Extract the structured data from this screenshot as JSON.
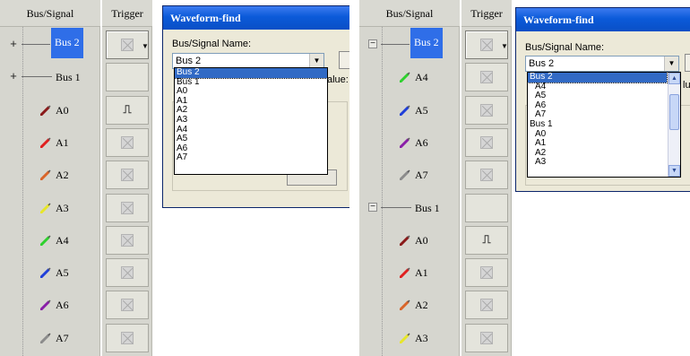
{
  "colors": {
    "selection": "#2f6ee8",
    "titlebar": "#0b5ad9",
    "dialog_bg": "#ece9d8",
    "list_highlight": "#316ac5"
  },
  "left_panel": {
    "headers": {
      "signal": "Bus/Signal",
      "trigger": "Trigger"
    },
    "rows": [
      {
        "expander": "+",
        "name": "Bus 2",
        "kind": "bus",
        "selected": true
      },
      {
        "expander": "+",
        "name": "Bus 1",
        "kind": "bus",
        "selected": false
      },
      {
        "name": "A0",
        "color": "#8a1a1a",
        "trigger": "rising-edge-icon"
      },
      {
        "name": "A1",
        "color": "#e02020"
      },
      {
        "name": "A2",
        "color": "#d9652a"
      },
      {
        "name": "A3",
        "color": "#e7e62a"
      },
      {
        "name": "A4",
        "color": "#2ed12e"
      },
      {
        "name": "A5",
        "color": "#1f3fd9"
      },
      {
        "name": "A6",
        "color": "#8a1fa8"
      },
      {
        "name": "A7",
        "color": "#8c8c8c"
      }
    ],
    "dialog": {
      "title": "Waveform-find",
      "name_label": "Bus/Signal Name:",
      "combo_value": "Bus 2",
      "value_peek": "alue:",
      "options": [
        "Bus 2",
        "Bus 1",
        "A0",
        "A1",
        "A2",
        "A3",
        "A4",
        "A5",
        "A6",
        "A7"
      ],
      "selected_option": "Bus 2"
    }
  },
  "right_panel": {
    "headers": {
      "signal": "Bus/Signal",
      "trigger": "Trigger"
    },
    "rows": [
      {
        "expander": "−",
        "name": "Bus 2",
        "kind": "bus",
        "selected": true
      },
      {
        "name": "A4",
        "color": "#2ed12e"
      },
      {
        "name": "A5",
        "color": "#1f3fd9"
      },
      {
        "name": "A6",
        "color": "#8a1fa8"
      },
      {
        "name": "A7",
        "color": "#8c8c8c"
      },
      {
        "expander": "−",
        "name": "Bus 1",
        "kind": "bus",
        "selected": false
      },
      {
        "name": "A0",
        "color": "#8a1a1a",
        "trigger": "rising-edge-icon"
      },
      {
        "name": "A1",
        "color": "#e02020"
      },
      {
        "name": "A2",
        "color": "#d9652a"
      },
      {
        "name": "A3",
        "color": "#e7e62a"
      }
    ],
    "dialog": {
      "title": "Waveform-find",
      "name_label": "Bus/Signal Name:",
      "combo_value": "Bus 2",
      "value_peek": "lu",
      "options": [
        {
          "text": "Bus 2",
          "indent": false
        },
        {
          "text": "A4",
          "indent": true
        },
        {
          "text": "A5",
          "indent": true
        },
        {
          "text": "A6",
          "indent": true
        },
        {
          "text": "A7",
          "indent": true
        },
        {
          "text": "Bus 1",
          "indent": false
        },
        {
          "text": "A0",
          "indent": true
        },
        {
          "text": "A1",
          "indent": true
        },
        {
          "text": "A2",
          "indent": true
        },
        {
          "text": "A3",
          "indent": true
        }
      ],
      "selected_option": "Bus 2"
    }
  }
}
